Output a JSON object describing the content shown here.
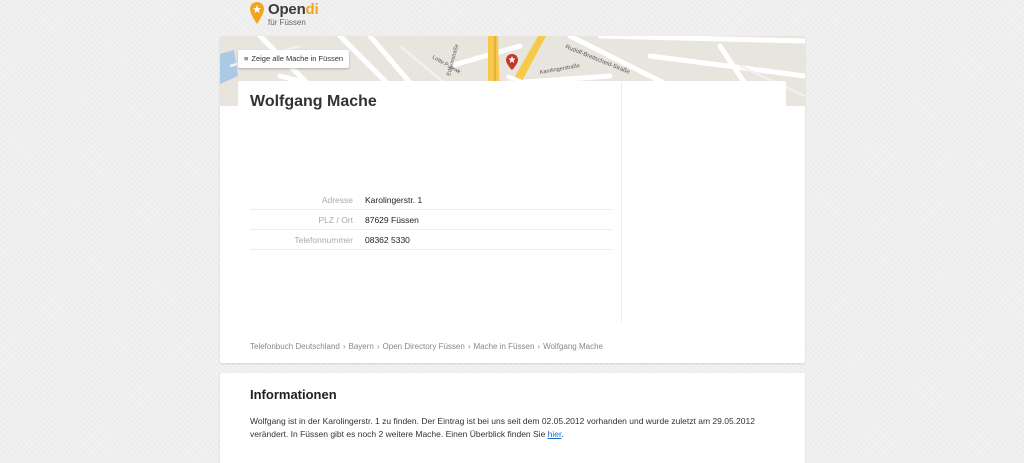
{
  "logo": {
    "brand_main": "Open",
    "brand_accent": "di",
    "subtitle": "für Füssen"
  },
  "map": {
    "button_label": "Zeige alle Mache in Füssen",
    "street_labels": [
      "Rudolf-Breitscheid-Straße",
      "Edisonstraße",
      "Karolingerstraße",
      "Lotte Pulewk"
    ]
  },
  "entry": {
    "name": "Wolfgang Mache",
    "details": [
      {
        "label": "Adresse",
        "value": "Karolingerstr. 1"
      },
      {
        "label": "PLZ / Ort",
        "value": "87629 Füssen"
      },
      {
        "label": "Telefonnummer",
        "value": "08362 5330"
      }
    ]
  },
  "breadcrumb": [
    "Telefonbuch Deutschland",
    "Bayern",
    "Open Directory Füssen",
    "Mache in Füssen",
    "Wolfgang Mache"
  ],
  "breadcrumb_separator": "›",
  "info": {
    "heading": "Informationen",
    "text_before_link": "Wolfgang ist in der Karolingerstr. 1 zu finden. Der Eintrag ist bei uns seit dem 02.05.2012 vorhanden und wurde zuletzt am 29.05.2012 verändert. In Füssen gibt es noch 2 weitere Mache. Einen Überblick finden Sie ",
    "link_text": "hier",
    "text_after_link": "."
  },
  "colors": {
    "accent": "#f2a51c",
    "map_marker": "#c0392b",
    "link": "#1a6fc9"
  }
}
